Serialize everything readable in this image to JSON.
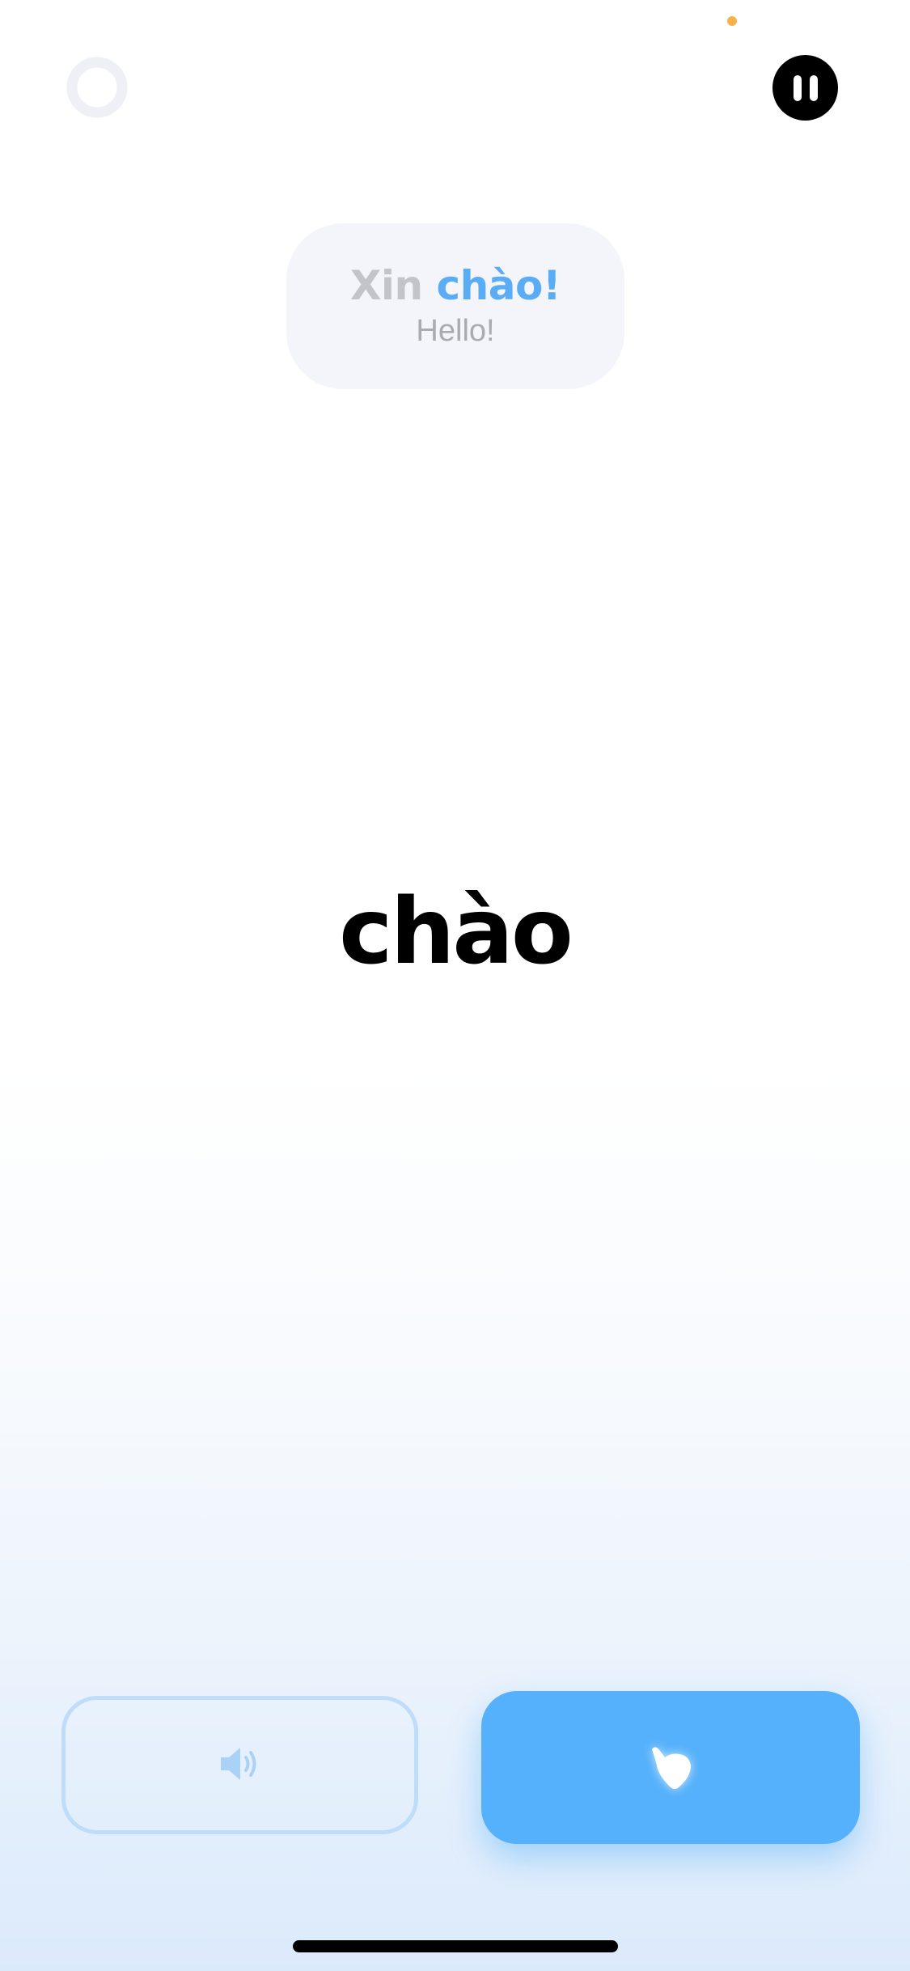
{
  "phrase": {
    "prefix": "Xin ",
    "highlight": "chào!",
    "translation": "Hello!"
  },
  "target_word": "chào",
  "icons": {
    "progress": "progress-ring-icon",
    "pause": "pause-icon",
    "listen": "speaker-icon",
    "record": "hand-icon"
  },
  "colors": {
    "accent": "#55b1fb",
    "accent_text": "#5aadf5",
    "dim_text": "#c2c4ca",
    "recording_dot": "#f8b24a",
    "card_background": "#f3f5fa"
  }
}
